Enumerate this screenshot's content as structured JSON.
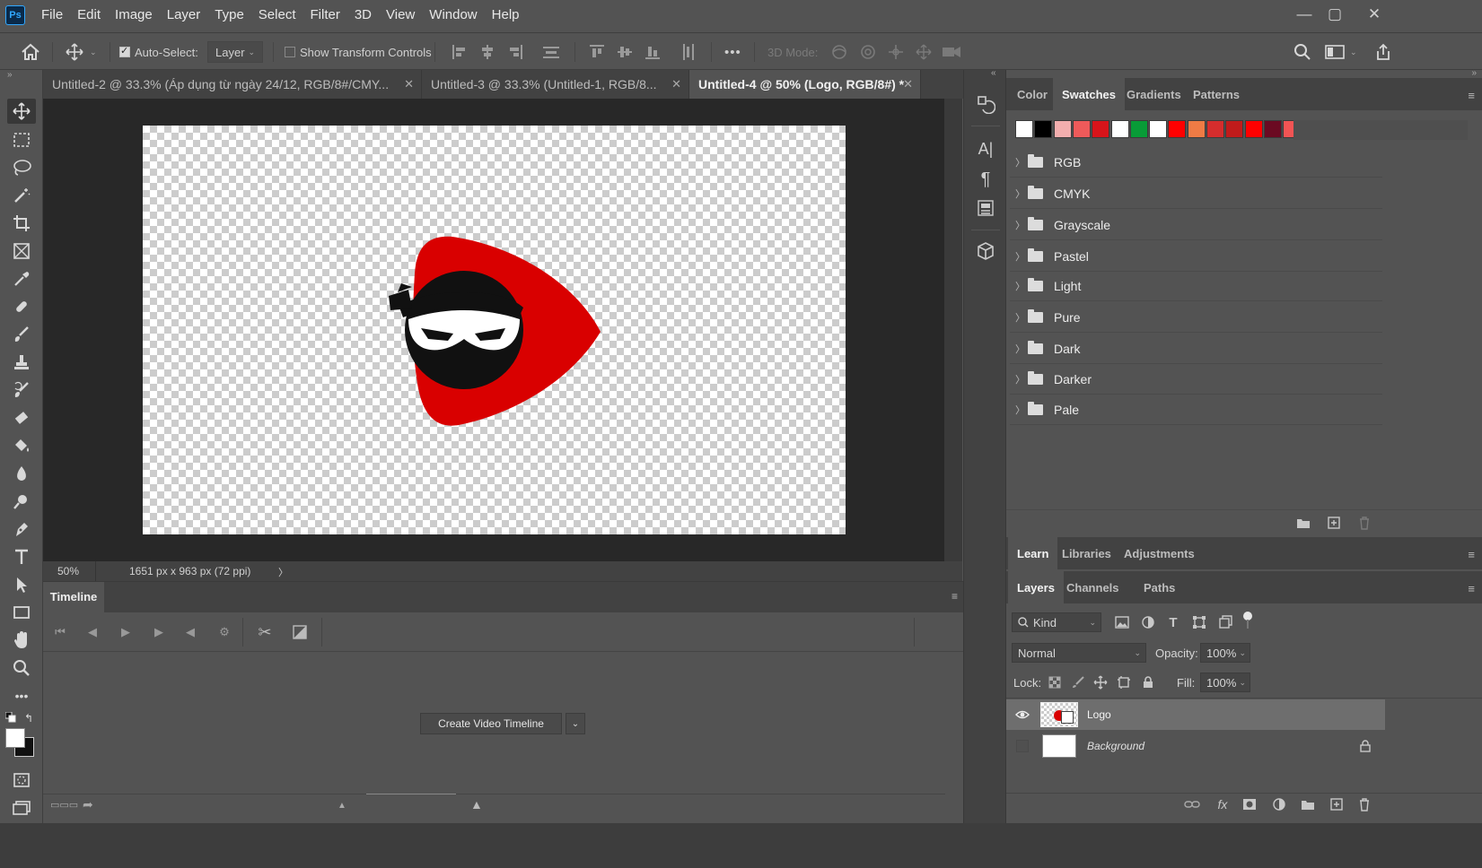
{
  "app": {
    "logo_text": "Ps"
  },
  "menu": [
    "File",
    "Edit",
    "Image",
    "Layer",
    "Type",
    "Select",
    "Filter",
    "3D",
    "View",
    "Window",
    "Help"
  ],
  "window_controls": {
    "minimize": "—",
    "restore": "▢",
    "close": "✕"
  },
  "options_bar": {
    "auto_select_label": "Auto-Select:",
    "auto_select_value": "Layer",
    "show_transform_label": "Show Transform Controls",
    "more": "•••",
    "mode_3d_label": "3D Mode:"
  },
  "documents": [
    {
      "title": "Untitled-2 @ 33.3% (Áp dụng từ ngày 24/12, RGB/8#/CMY...",
      "close": "✕"
    },
    {
      "title": "Untitled-3 @ 33.3% (Untitled-1, RGB/8...",
      "close": "✕"
    },
    {
      "title": "Untitled-4 @ 50% (Logo, RGB/8#) *",
      "close": "✕"
    }
  ],
  "status": {
    "zoom": "50%",
    "doc_info": "1651 px x 963 px (72 ppi)",
    "arrow": "〉"
  },
  "timeline": {
    "tab": "Timeline",
    "create_button": "Create Video Timeline"
  },
  "panel_top": {
    "tabs": [
      "Color",
      "Swatches",
      "Gradients",
      "Patterns"
    ],
    "active_tab": "Swatches",
    "swatch_colors": [
      "#ffffff",
      "#000000",
      "#f2aeae",
      "#ee5a5a",
      "#d7141a",
      "#ffffff",
      "#089b37",
      "#ffffff",
      "#ff0000",
      "#ef7b45",
      "#d52d2d",
      "#c11b1b",
      "#ff0000",
      "#6b0a22",
      "#f25454"
    ],
    "groups": [
      "RGB",
      "CMYK",
      "Grayscale",
      "Pastel",
      "Light",
      "Pure",
      "Dark",
      "Darker",
      "Pale"
    ]
  },
  "panel_learn": {
    "tabs": [
      "Learn",
      "Libraries",
      "Adjustments"
    ],
    "active_tab": "Learn"
  },
  "panel_layers": {
    "tabs": [
      "Layers",
      "Channels",
      "Paths"
    ],
    "active_tab": "Layers",
    "filter_label": "Kind",
    "blend_mode": "Normal",
    "opacity_label": "Opacity:",
    "opacity_value": "100%",
    "lock_label": "Lock:",
    "fill_label": "Fill:",
    "fill_value": "100%",
    "layers": [
      {
        "name": "Logo",
        "visible": true,
        "selected": true
      },
      {
        "name": "Background",
        "visible": false,
        "selected": false,
        "locked": true
      }
    ]
  },
  "colors": {
    "accent_red": "#d90000",
    "ninja_black": "#111111"
  }
}
